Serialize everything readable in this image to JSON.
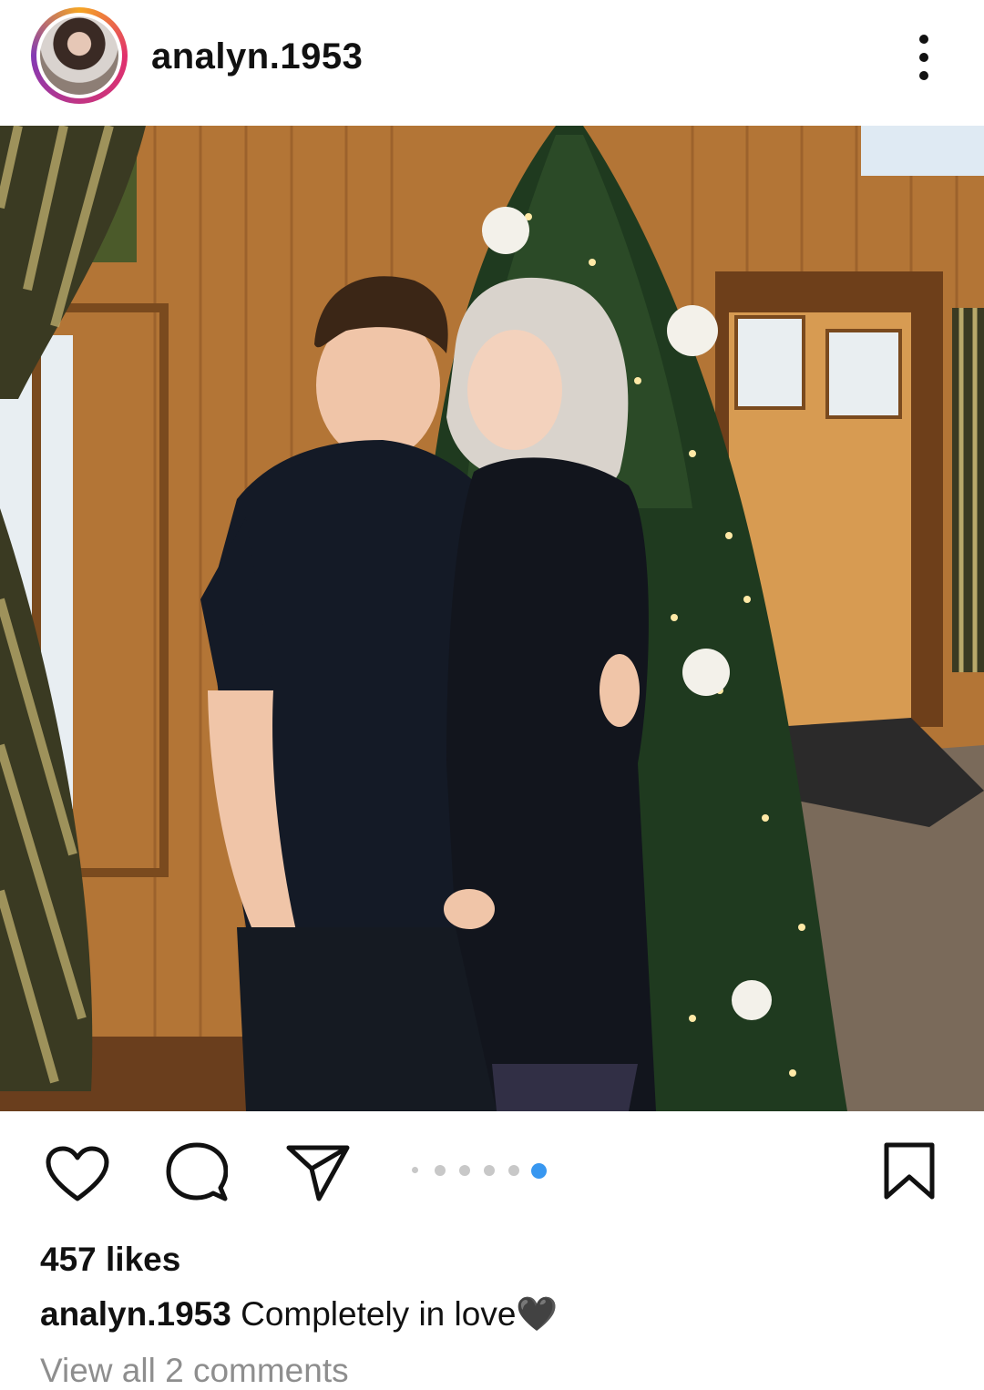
{
  "post": {
    "username": "analyn.1953",
    "likes": "457 likes",
    "caption_user": "analyn.1953",
    "caption_text": "Completely in love🖤",
    "comments_link": "View all 2 comments",
    "carousel": {
      "total": 6,
      "active_index": 5
    }
  },
  "icons": {
    "more": "more-vertical-icon",
    "like": "heart-icon",
    "comment": "comment-bubble-icon",
    "share": "paper-plane-icon",
    "save": "bookmark-icon"
  },
  "colors": {
    "accent": "#3897f0",
    "text": "#111111",
    "muted": "#8e8e8e"
  }
}
